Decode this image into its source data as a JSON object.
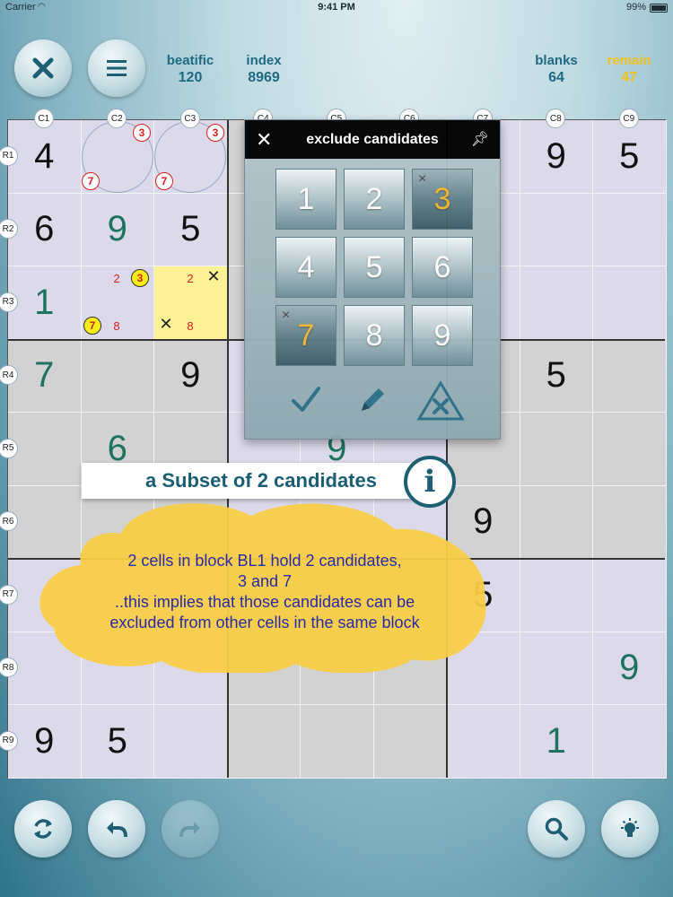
{
  "status_bar": {
    "carrier": "Carrier",
    "time": "9:41 PM",
    "battery": "99%"
  },
  "header": {
    "stats": [
      {
        "label": "beatific",
        "value": "120"
      },
      {
        "label": "index",
        "value": "8969"
      },
      {
        "label": "blanks",
        "value": "64"
      },
      {
        "label": "remain",
        "value": "47"
      }
    ]
  },
  "board": {
    "col_labels": [
      "C1",
      "C2",
      "C3",
      "C4",
      "C5",
      "C6",
      "C7",
      "C8",
      "C9"
    ],
    "row_labels": [
      "R1",
      "R2",
      "R3",
      "R4",
      "R5",
      "R6",
      "R7",
      "R8",
      "R9"
    ],
    "cells": {
      "r1c1": "4",
      "r1c8": "9",
      "r1c9": "5",
      "r2c1": "6",
      "r2c2": "9",
      "r2c3": "5",
      "r3c1": "1",
      "r4c1": "7",
      "r4c3": "9",
      "r4c8": "5",
      "r5c2": "6",
      "r5c5": "9",
      "r6c7": "9",
      "r7c7": "5",
      "r8c9": "9",
      "r9c1": "9",
      "r9c2": "5",
      "r9c8": "1"
    },
    "candidates": {
      "r1c2": [
        "3",
        "7"
      ],
      "r1c3": [
        "3",
        "7"
      ],
      "r3c2": [
        "2",
        "3",
        "7",
        "8"
      ],
      "r3c3": [
        "2",
        "8"
      ]
    }
  },
  "exclude_panel": {
    "title": "exclude candidates",
    "keys": [
      "1",
      "2",
      "3",
      "4",
      "5",
      "6",
      "7",
      "8",
      "9"
    ],
    "active_keys": [
      "3",
      "7"
    ]
  },
  "hint": {
    "banner": "a Subset of 2 candidates",
    "info_icon_text": "i",
    "lines": [
      "2 cells in block BL1 hold 2 candidates,",
      "3 and 7",
      "..this implies that those candidates can be",
      "excluded from other cells in the same block"
    ]
  },
  "colors": {
    "accent": "#1e5f74",
    "highlight": "#fdf196",
    "candidate": "#d42020",
    "hint_text": "#2a2aa8",
    "cloud": "#f8cd47",
    "remain": "#f3c21c"
  }
}
